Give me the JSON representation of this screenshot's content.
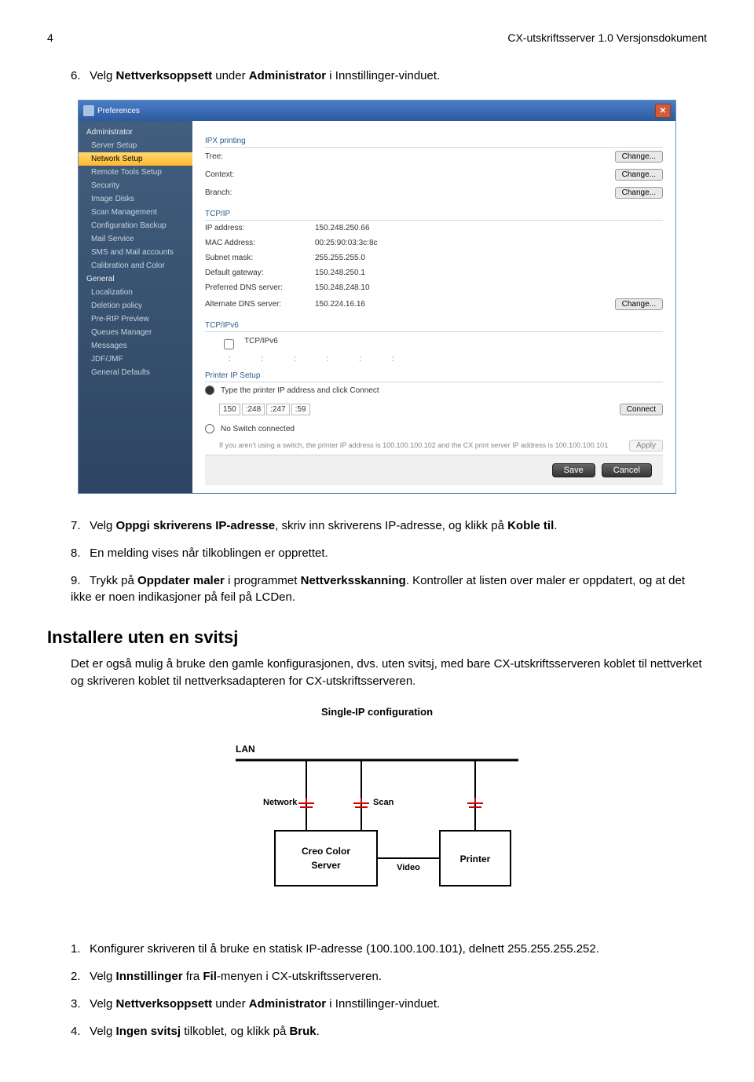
{
  "header": {
    "page_num": "4",
    "doc_title": "CX-utskriftsserver 1.0 Versjonsdokument"
  },
  "steps_a": [
    {
      "n": "6.",
      "pre": "Velg ",
      "b1": "Nettverksoppsett",
      "mid": " under ",
      "b2": "Administrator",
      "post": " i Innstillinger-vinduet."
    }
  ],
  "prefs": {
    "title": "Preferences",
    "sidebar": {
      "group1": "Administrator",
      "items1": [
        "Server Setup",
        "Network Setup",
        "Remote Tools Setup",
        "Security",
        "Image Disks",
        "Scan Management",
        "Configuration Backup",
        "Mail Service",
        "SMS and Mail accounts",
        "Calibration and Color"
      ],
      "group2": "General",
      "items2": [
        "Localization",
        "Deletion policy",
        "Pre-RIP Preview",
        "Queues Manager",
        "Messages",
        "JDF/JMF",
        "General Defaults"
      ]
    },
    "ipx": {
      "head": "IPX printing",
      "rows": [
        {
          "k": "Tree:",
          "v": "",
          "btn": "Change..."
        },
        {
          "k": "Context:",
          "v": "",
          "btn": "Change..."
        },
        {
          "k": "Branch:",
          "v": "",
          "btn": "Change..."
        }
      ]
    },
    "tcp": {
      "head": "TCP/IP",
      "rows": [
        {
          "k": "IP address:",
          "v": "150.248.250.66"
        },
        {
          "k": "MAC Address:",
          "v": "00:25:90:03:3c:8c"
        },
        {
          "k": "Subnet mask:",
          "v": "255.255.255.0"
        },
        {
          "k": "Default gateway:",
          "v": "150.248.250.1"
        },
        {
          "k": "Preferred DNS server:",
          "v": "150.248.248.10"
        },
        {
          "k": "Alternate DNS server:",
          "v": "150.224.16.16",
          "btn": "Change..."
        }
      ]
    },
    "tcp6": {
      "head": "TCP/IPv6",
      "label": "TCP/IPv6"
    },
    "pip": {
      "head": "Printer IP Setup",
      "r1": "Type the printer IP address and click Connect",
      "ip": [
        "150",
        ":248",
        ":247",
        ":59"
      ],
      "connect": "Connect",
      "r2": "No Switch connected",
      "help": "If you aren't using a switch, the printer IP address is 100.100.100.102 and the CX print server IP address is 100.100.100.101",
      "apply": "Apply"
    },
    "footer": {
      "save": "Save",
      "cancel": "Cancel"
    }
  },
  "steps_b": [
    {
      "n": "7.",
      "pre": "Velg ",
      "b1": "Oppgi skriverens IP-adresse",
      "mid": ", skriv inn skriverens IP-adresse, og klikk på ",
      "b2": "Koble til",
      "post": "."
    },
    {
      "n": "8.",
      "pre": "En melding vises når tilkoblingen er opprettet.",
      "b1": "",
      "mid": "",
      "b2": "",
      "post": ""
    },
    {
      "n": "9.",
      "pre": "Trykk på ",
      "b1": "Oppdater maler",
      "mid": " i programmet ",
      "b2": "Nettverksskanning",
      "post": ". Kontroller at listen over maler er oppdatert, og at det ikke er noen indikasjoner på feil på LCDen."
    }
  ],
  "install": {
    "title": "Installere uten en svitsj",
    "para": "Det er også mulig å bruke den gamle konfigurasjonen, dvs. uten svitsj, med bare CX-utskriftsserveren koblet til nettverket og skriveren koblet til nettverksadapteren for CX-utskriftsserveren."
  },
  "diagram": {
    "title": "Single-IP configuration",
    "lan": "LAN",
    "network": "Network",
    "scan": "Scan",
    "server": "Creo Color Server",
    "video": "Video",
    "printer": "Printer"
  },
  "steps_c": [
    {
      "n": "1.",
      "pre": "Konfigurer skriveren til å bruke en statisk IP-adresse (100.100.100.101), delnett 255.255.255.252.",
      "b1": "",
      "mid": "",
      "b2": "",
      "post": ""
    },
    {
      "n": "2.",
      "pre": "Velg ",
      "b1": "Innstillinger",
      "mid": " fra ",
      "b2": "Fil",
      "post": "-menyen i CX-utskriftsserveren."
    },
    {
      "n": "3.",
      "pre": "Velg ",
      "b1": "Nettverksoppsett",
      "mid": " under ",
      "b2": "Administrator",
      "post": " i Innstillinger-vinduet."
    },
    {
      "n": "4.",
      "pre": "Velg ",
      "b1": "Ingen svitsj",
      "mid": " tilkoblet, og klikk på ",
      "b2": "Bruk",
      "post": "."
    }
  ]
}
